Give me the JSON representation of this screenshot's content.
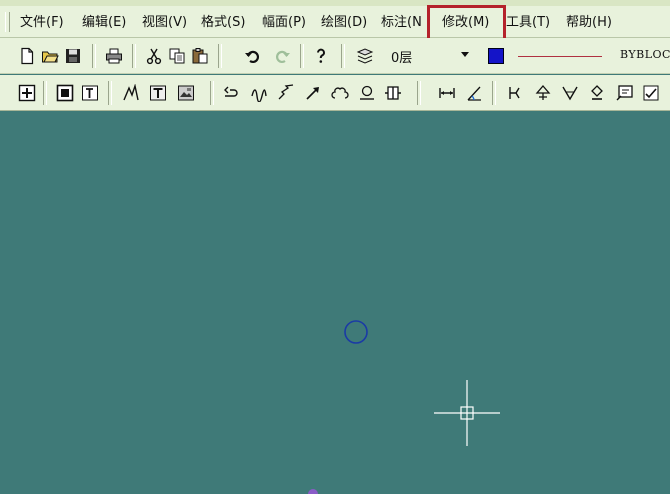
{
  "menu": {
    "items": [
      {
        "key": "file",
        "label": "文件(F)"
      },
      {
        "key": "edit",
        "label": "编辑(E)"
      },
      {
        "key": "view",
        "label": "视图(V)"
      },
      {
        "key": "format",
        "label": "格式(S)"
      },
      {
        "key": "layout",
        "label": "幅面(P)"
      },
      {
        "key": "draw",
        "label": "绘图(D)"
      },
      {
        "key": "dimension",
        "label": "标注(N"
      },
      {
        "key": "modify",
        "label": "修改(M)"
      },
      {
        "key": "tools",
        "label": "工具(T)"
      },
      {
        "key": "help",
        "label": "帮助(H)"
      }
    ],
    "highlighted": "modify",
    "highlight_color": "#b4222b"
  },
  "properties": {
    "layer": "0层",
    "color": "#1414c8",
    "linetype_color": "#b03040",
    "linetype_label": "BYBLOCI"
  },
  "toolbar1_icons": [
    "new-icon",
    "open-icon",
    "save-icon",
    "print-icon",
    "cut-icon",
    "copy-icon",
    "paste-icon",
    "undo-icon",
    "redo-icon",
    "help-icon",
    "layer-manager-icon"
  ],
  "toolbar2_icons": [
    "zoom-window-icon",
    "zoom-all-icon",
    "text-frame-icon",
    "polyline-tool-icon",
    "text-tool-icon",
    "image-tool-icon",
    "connector-icon",
    "wave-icon",
    "zigzag-icon",
    "arrow-icon",
    "cloud-icon",
    "symbol-icon",
    "block-icon",
    "dimension-linear-icon",
    "dimension-angular-icon",
    "symbol-tool-1-icon",
    "symbol-tool-2-icon",
    "symbol-tool-3-icon",
    "symbol-tool-4-icon",
    "frame-tool-icon",
    "check-icon"
  ],
  "canvas": {
    "background": "#3f7a78"
  }
}
